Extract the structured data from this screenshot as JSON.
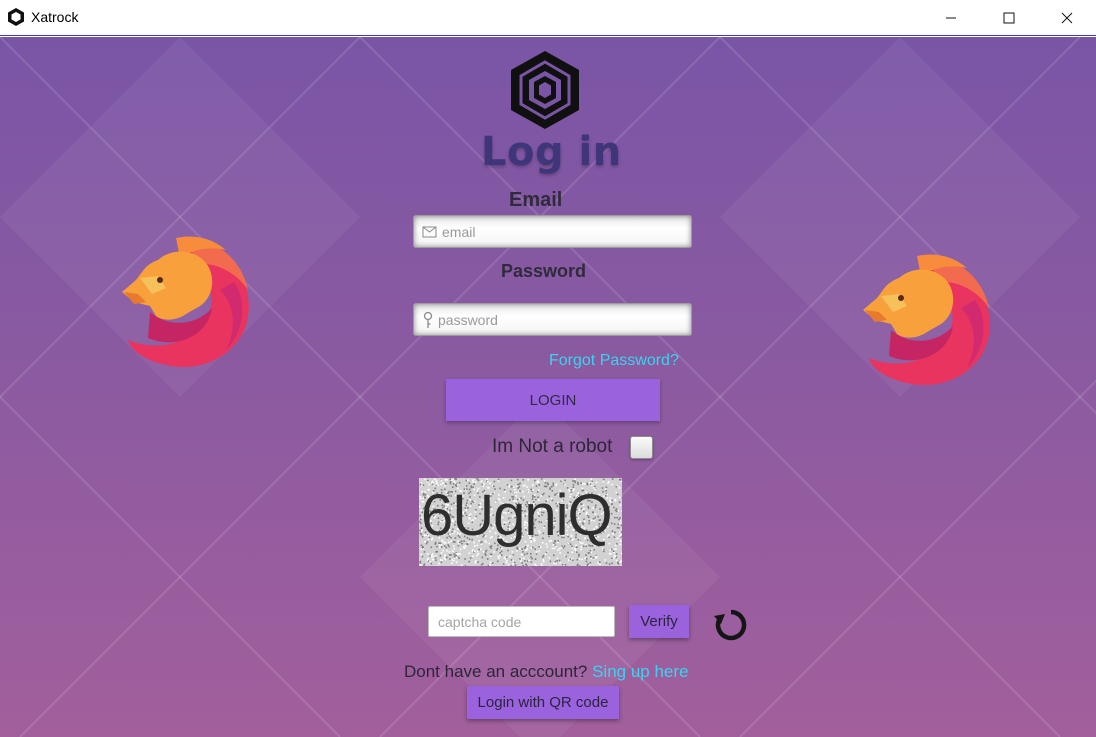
{
  "window": {
    "title": "Xatrock",
    "controls": {
      "minimize": "minimize-icon",
      "maximize": "maximize-icon",
      "close": "close-icon"
    }
  },
  "login": {
    "heading": "Log in",
    "email_label": "Email",
    "email_placeholder": "email",
    "password_label": "Password",
    "password_placeholder": "password",
    "forgot_password": "Forgot Password?",
    "login_button": "LOGIN",
    "robot_label": "Im Not a robot",
    "robot_checked": false
  },
  "captcha": {
    "code": "6UgniQ",
    "input_placeholder": "captcha code",
    "verify_button": "Verify",
    "refresh_icon": "refresh-icon"
  },
  "signup": {
    "prompt": "Dont have an acccount?",
    "link": "Sing up here"
  },
  "qr": {
    "button": "Login with QR code"
  },
  "colors": {
    "background_top": "#7a55a6",
    "background_bottom": "#a25f9c",
    "button_purple": "#9a62dd",
    "link_cyan": "#39d4f0",
    "heading": "#3f3579"
  }
}
